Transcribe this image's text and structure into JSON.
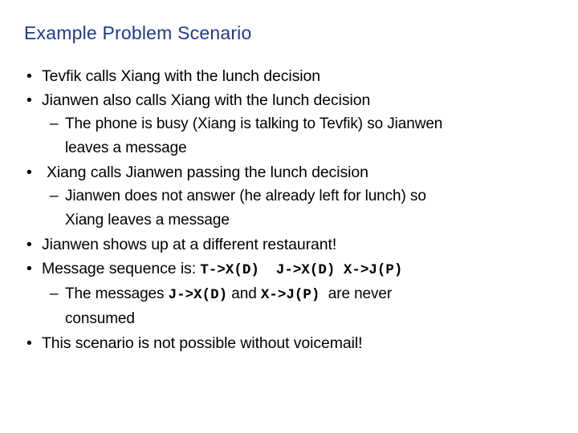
{
  "slide": {
    "title": "Example Problem Scenario",
    "title_color": "#1F3A8F",
    "text_color": "#000000",
    "background_color": "#ffffff",
    "bullet_marker": "•",
    "dash_marker": "–"
  },
  "content": {
    "b1": "Tevfik calls Xiang with the lunch decision",
    "b2": "Jianwen also calls Xiang with the lunch decision",
    "b2s1_line1": "The phone is busy (Xiang is talking to Tevfik) so Jianwen",
    "b2s1_line2": "leaves a message",
    "b3": "Xiang calls Jianwen passing the lunch decision",
    "b3s1_line1": "Jianwen does not answer (he already left for lunch) so",
    "b3s1_line2": "Xiang leaves a message",
    "b4": "Jianwen shows up at a different restaurant!",
    "b5_prefix": "Message sequence is: ",
    "b5_mono": "T->X(D)  J->X(D) X->J(P)",
    "b5s1_prefix": "The messages ",
    "b5s1_mono1": "J->X(D)",
    "b5s1_middle": " and ",
    "b5s1_mono2": "X->J(P)",
    "b5s1_suffix": "  are never",
    "b5s1_line2": "consumed",
    "b6": "This scenario is not possible without voicemail!"
  }
}
